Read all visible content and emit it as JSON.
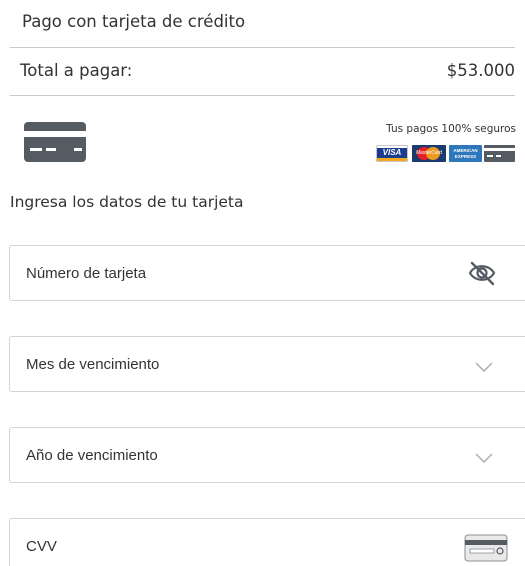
{
  "header": {
    "title": "Pago con tarjeta de crédito"
  },
  "summary": {
    "total_label": "Total a pagar:",
    "total_value": "$53.000"
  },
  "security": {
    "text": "Tus pagos 100% seguros",
    "brands": [
      {
        "name": "VISA",
        "icon": "visa-logo"
      },
      {
        "name": "MasterCard",
        "icon": "mastercard-logo"
      },
      {
        "name": "AMERICAN EXPRESS",
        "icon": "amex-logo"
      },
      {
        "name": "",
        "icon": "generic-card-icon"
      }
    ]
  },
  "form": {
    "section_title": "Ingresa los datos de tu tarjeta",
    "fields": [
      {
        "label": "Número de tarjeta",
        "icon": "eye-off-icon"
      },
      {
        "label": "Mes de vencimiento",
        "icon": "chevron-down-icon"
      },
      {
        "label": "Año de vencimiento",
        "icon": "chevron-down-icon"
      },
      {
        "label": "CVV",
        "icon": "card-back-icon"
      }
    ]
  },
  "colors": {
    "text": "#333333",
    "divider": "#c9c9c9",
    "border": "#d5d5d5",
    "icon": "#555b63",
    "chevron": "#aaaaaa"
  }
}
